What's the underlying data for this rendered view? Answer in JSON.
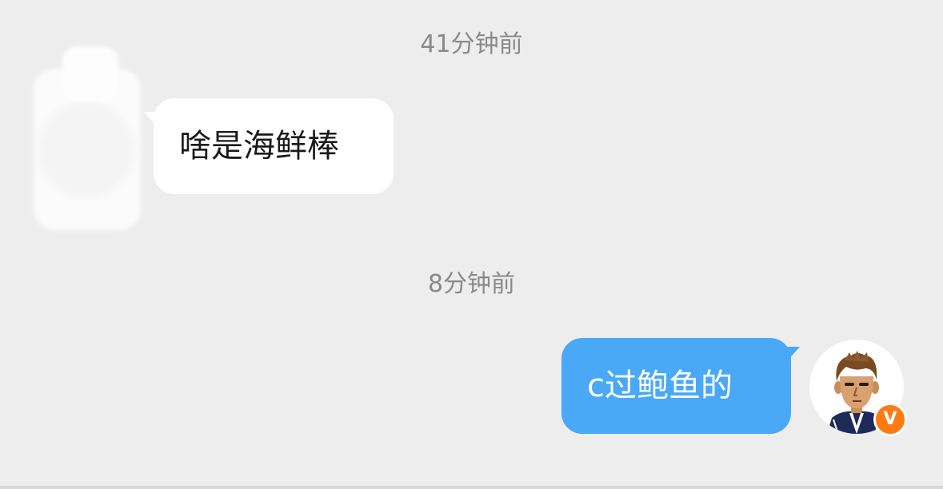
{
  "conversation": {
    "messages": [
      {
        "timestamp": "41分钟前",
        "sender": "contact",
        "text": "啥是海鲜棒"
      },
      {
        "timestamp": "8分钟前",
        "sender": "me",
        "text": "c过鲍鱼的"
      }
    ]
  },
  "badges": {
    "vip_letter": "V"
  },
  "colors": {
    "background": "#ededed",
    "incoming_bubble": "#ffffff",
    "outgoing_bubble": "#4aa9f7",
    "timestamp_text": "#8a8a8a",
    "vip_badge": "#ff7a12"
  },
  "icons": {
    "contact_avatar": "blurred-avatar",
    "my_avatar": "cartoon-avatar-icon",
    "vip_badge": "vip-badge-icon"
  }
}
